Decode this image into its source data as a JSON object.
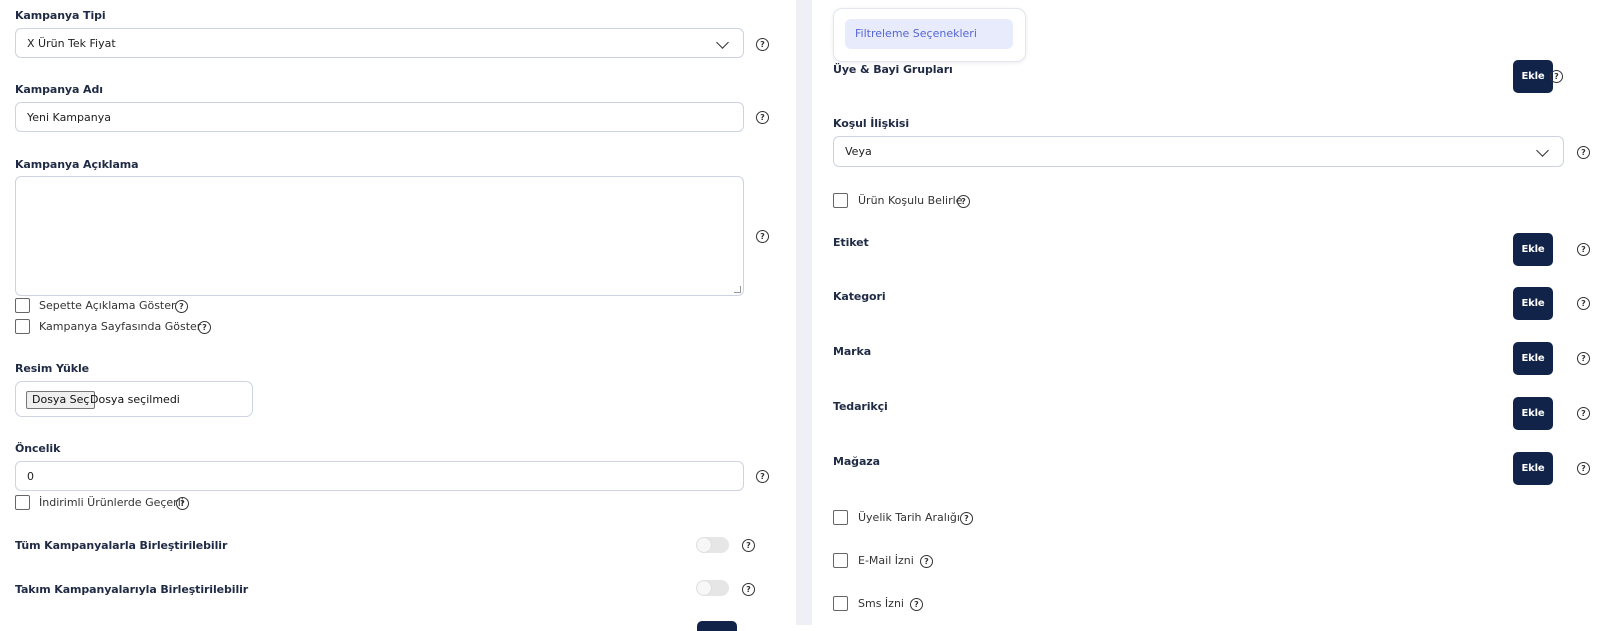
{
  "left": {
    "campaign_type": {
      "label": "Kampanya Tipi",
      "value": "X Ürün Tek Fiyat"
    },
    "campaign_name": {
      "label": "Kampanya Adı",
      "value": "Yeni Kampanya"
    },
    "campaign_description": {
      "label": "Kampanya Açıklama",
      "value": ""
    },
    "show_in_cart": {
      "label": "Sepette Açıklama Göster"
    },
    "show_on_campaign_page": {
      "label": "Kampanya Sayfasında Göster"
    },
    "image_upload": {
      "label": "Resim Yükle",
      "button": "Dosya Seç",
      "status": "Dosya seçilmedi"
    },
    "priority": {
      "label": "Öncelik",
      "value": "0"
    },
    "valid_on_discounted": {
      "label": "İndirimli Ürünlerde Geçerli"
    },
    "combine_all": {
      "label": "Tüm Kampanyalarla Birleştirilebilir"
    },
    "combine_team": {
      "label": "Takım Kampanyalarıyla Birleştirilebilir"
    }
  },
  "right": {
    "filter_tab": "Filtreleme Seçenekleri",
    "member_groups": {
      "label": "Üye & Bayi Grupları",
      "button": "Ekle"
    },
    "condition_relation": {
      "label": "Koşul İlişkisi",
      "value": "Veya"
    },
    "product_condition": {
      "label": "Ürün Koşulu Belirle"
    },
    "tag": {
      "label": "Etiket",
      "button": "Ekle"
    },
    "category": {
      "label": "Kategori",
      "button": "Ekle"
    },
    "brand": {
      "label": "Marka",
      "button": "Ekle"
    },
    "supplier": {
      "label": "Tedarikçi",
      "button": "Ekle"
    },
    "store": {
      "label": "Mağaza",
      "button": "Ekle"
    },
    "membership_date_range": {
      "label": "Üyelik Tarih Aralığı"
    },
    "email_permission": {
      "label": "E-Mail İzni"
    },
    "sms_permission": {
      "label": "Sms İzni"
    }
  },
  "help_glyph": "?",
  "colors": {
    "accent_button": "#12234a",
    "tab_bg": "#e8ebfb",
    "tab_text": "#5566d6",
    "divider": "#eef0f6"
  }
}
